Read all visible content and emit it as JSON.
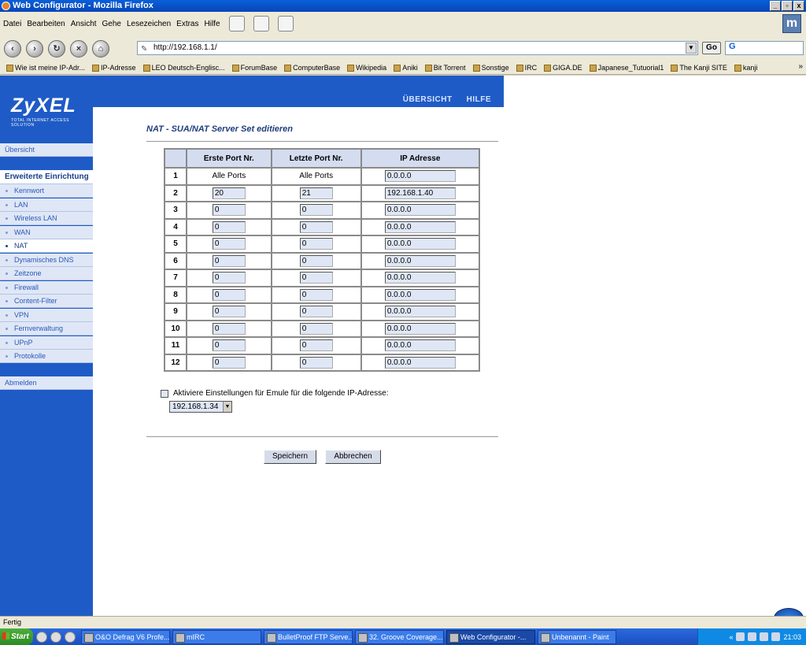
{
  "window": {
    "title": "Web Configurator - Mozilla Firefox",
    "controls": [
      "_",
      "▫",
      "x"
    ]
  },
  "menu": [
    "Datei",
    "Bearbeiten",
    "Ansicht",
    "Gehe",
    "Lesezeichen",
    "Extras",
    "Hilfe"
  ],
  "navbar": {
    "url": "http://192.168.1.1/",
    "go_label": "Go",
    "search_text": "G"
  },
  "bookmarks": [
    "Wie ist meine IP-Adr...",
    "IP-Adresse",
    "LEO Deutsch-Englisc...",
    "ForumBase",
    "ComputerBase",
    "Wikipedia",
    "Aniki",
    "Bit Torrent",
    "Sonstige",
    "IRC",
    "GIGA.DE",
    "Japanese_Tutuorial1",
    "The Kanji SITE",
    "kanji"
  ],
  "brand": {
    "logo": "ZyXEL",
    "subtitle": "TOTAL INTERNET ACCESS SOLUTION"
  },
  "topnav": {
    "overview": "ÜBERSICHT",
    "help": "HILFE"
  },
  "sidebar": {
    "overview": "Übersicht",
    "section": "Erweiterte Einrichtung",
    "items": [
      "Kennwort",
      "LAN",
      "Wireless LAN",
      "WAN",
      "NAT",
      "Dynamisches DNS",
      "Zeitzone",
      "Firewall",
      "Content-Filter",
      "VPN",
      "Fernverwaltung",
      "UPnP",
      "Protokolle"
    ],
    "active": "NAT",
    "logout": "Abmelden"
  },
  "page": {
    "title": "NAT - SUA/NAT Server Set editieren"
  },
  "table": {
    "headers": [
      "Erste Port Nr.",
      "Letzte Port Nr.",
      "IP Adresse"
    ],
    "rows": [
      {
        "n": "1",
        "first": "Alle Ports",
        "last": "Alle Ports",
        "ip": "0.0.0.0"
      },
      {
        "n": "2",
        "first": "20",
        "last": "21",
        "ip": "192.168.1.40"
      },
      {
        "n": "3",
        "first": "0",
        "last": "0",
        "ip": "0.0.0.0"
      },
      {
        "n": "4",
        "first": "0",
        "last": "0",
        "ip": "0.0.0.0"
      },
      {
        "n": "5",
        "first": "0",
        "last": "0",
        "ip": "0.0.0.0"
      },
      {
        "n": "6",
        "first": "0",
        "last": "0",
        "ip": "0.0.0.0"
      },
      {
        "n": "7",
        "first": "0",
        "last": "0",
        "ip": "0.0.0.0"
      },
      {
        "n": "8",
        "first": "0",
        "last": "0",
        "ip": "0.0.0.0"
      },
      {
        "n": "9",
        "first": "0",
        "last": "0",
        "ip": "0.0.0.0"
      },
      {
        "n": "10",
        "first": "0",
        "last": "0",
        "ip": "0.0.0.0"
      },
      {
        "n": "11",
        "first": "0",
        "last": "0",
        "ip": "0.0.0.0"
      },
      {
        "n": "12",
        "first": "0",
        "last": "0",
        "ip": "0.0.0.0"
      }
    ]
  },
  "emule": {
    "label": "Aktiviere Einstellungen für Emule für die folgende IP-Adresse:",
    "selected_ip": "192.168.1.34"
  },
  "buttons": {
    "save": "Speichern",
    "cancel": "Abbrechen"
  },
  "status": "Fertig",
  "taskbar": {
    "start": "Start",
    "tasks": [
      "O&O Defrag V6 Profe...",
      "mIRC",
      "BulletProof FTP Serve...",
      "32. Groove Coverage...",
      "Web Configurator -...",
      "Unbenannt - Paint"
    ],
    "active_task": "Web Configurator -...",
    "clock": "21:03"
  }
}
